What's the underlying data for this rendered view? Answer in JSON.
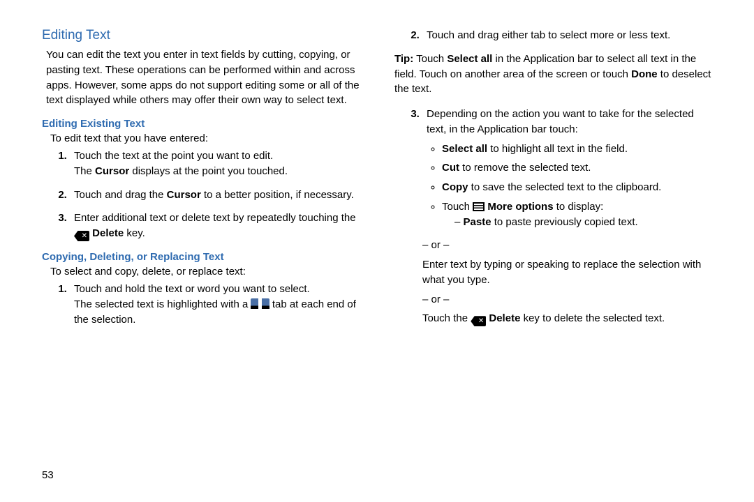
{
  "page_number": "53",
  "left": {
    "heading": "Editing Text",
    "intro": "You can edit the text you enter in text fields by cutting, copying, or pasting text. These operations can be performed within and across apps. However, some apps do not support editing some or all of the text displayed while others may offer their own way to select text.",
    "sub1_head": "Editing Existing Text",
    "sub1_intro": "To edit text that you have entered:",
    "s1_li1_a": "Touch the text at the point you want to edit.",
    "s1_li1_b_pre": "The ",
    "s1_li1_b_bold": "Cursor",
    "s1_li1_b_post": " displays at the point you touched.",
    "s1_li2_pre": "Touch and drag the ",
    "s1_li2_bold": "Cursor",
    "s1_li2_post": " to a better position, if necessary.",
    "s1_li3_pre": "Enter additional text or delete text by repeatedly touching the ",
    "s1_li3_bold": " Delete",
    "s1_li3_post": " key.",
    "sub2_head": "Copying, Deleting, or Replacing Text",
    "sub2_intro": "To select and copy, delete, or replace text:",
    "s2_li1_a": "Touch and hold the text or word you want to select.",
    "s2_li1_b_pre": "The selected text is highlighted with a ",
    "s2_li1_b_post": " tab at each end of the selection."
  },
  "right": {
    "s3_li2": "Touch and drag either tab to select more or less text.",
    "tip_label": "Tip:",
    "tip_pre": " Touch ",
    "tip_b1": "Select all",
    "tip_mid": " in the Application bar to select all text in the field. Touch on another area of the screen or touch ",
    "tip_b2": "Done",
    "tip_post": " to deselect the text.",
    "s3_li3_intro": "Depending on the action you want to take for the selected text, in the Application bar touch:",
    "b1_bold": "Select all",
    "b1_rest": " to highlight all text in the field.",
    "b2_bold": "Cut",
    "b2_rest": " to remove the selected text.",
    "b3_bold": "Copy",
    "b3_rest": " to save the selected text to the clipboard.",
    "b4_pre": "Touch ",
    "b4_bold": " More options",
    "b4_post": " to display:",
    "b4_sub_bold": "Paste",
    "b4_sub_rest": " to paste previously copied text.",
    "or": "– or –",
    "alt1": "Enter text by typing or speaking to replace the selection with what you type.",
    "alt2_pre": "Touch the ",
    "alt2_bold": " Delete",
    "alt2_post": " key to delete the selected text."
  }
}
